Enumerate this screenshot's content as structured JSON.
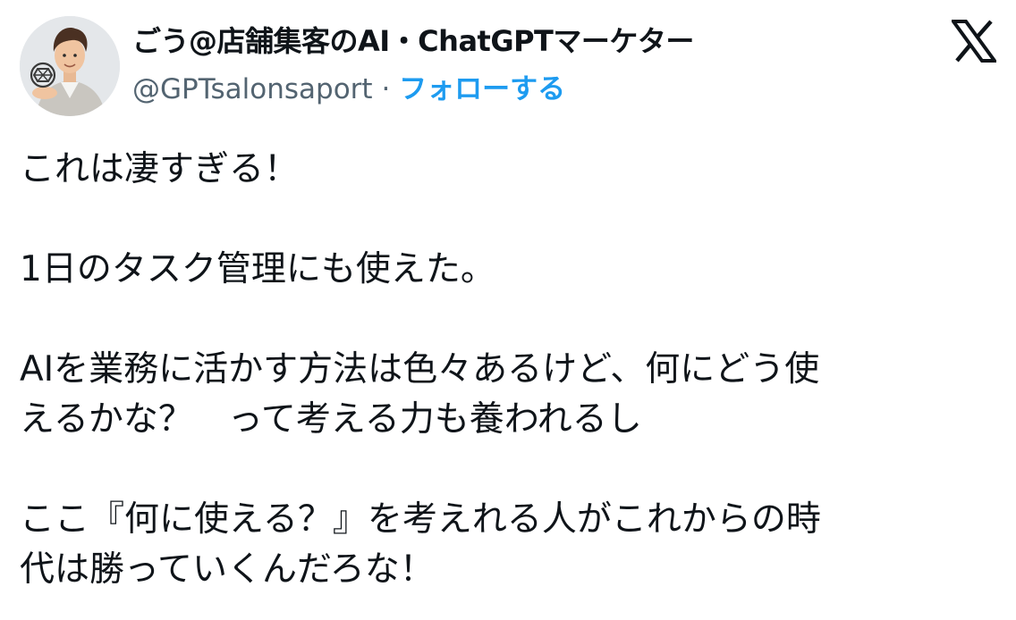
{
  "author": {
    "display_name": "ごう@店舗集客のAI・ChatGPTマーケター",
    "handle": "@GPTsalonsaport",
    "separator": "·",
    "follow_label": "フォローする",
    "avatar_icon": "avatar-openai-logo-icon"
  },
  "brand": {
    "logo_icon": "x-logo-icon",
    "accent_color": "#1d9bf0",
    "text_color": "#0f1419",
    "secondary_text_color": "#536471"
  },
  "tweet": {
    "paragraphs": [
      "これは凄すぎる！",
      "1日のタスク管理にも使えた。",
      "AIを業務に活かす方法は色々あるけど、何にどう使\nえるかな？　って考える力も養われるし",
      "ここ『何に使える？』を考えれる人がこれからの時\n代は勝っていくんだろな！"
    ]
  }
}
